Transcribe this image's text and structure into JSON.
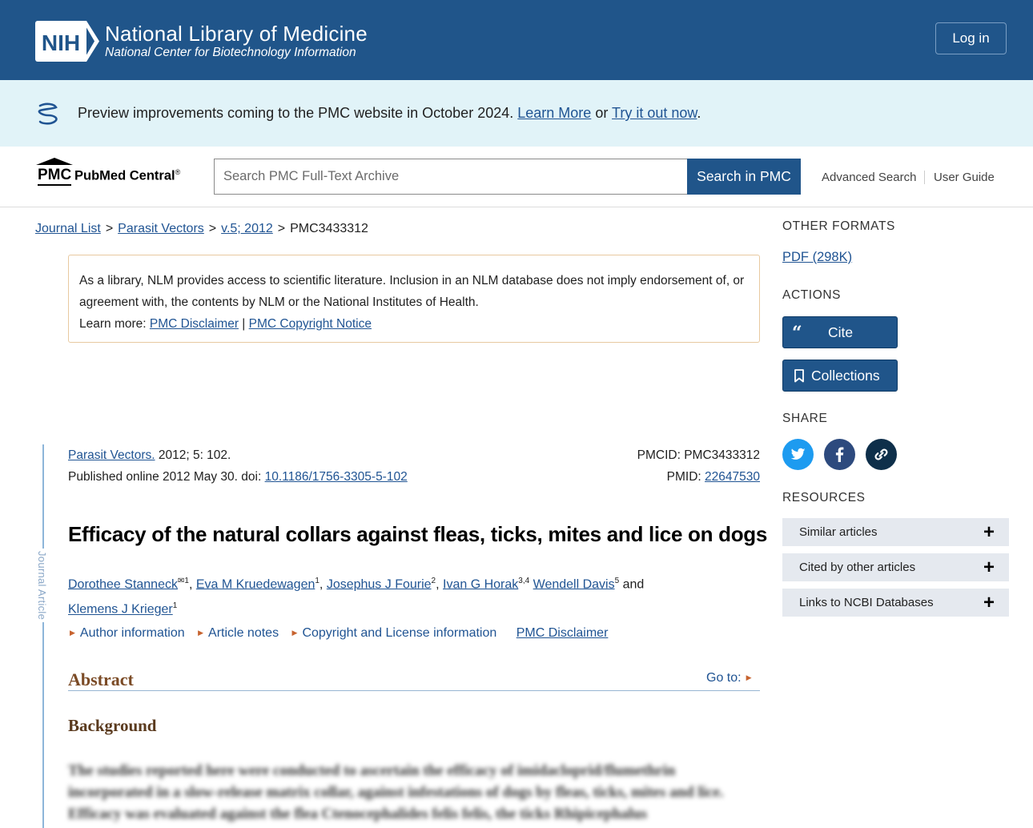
{
  "header": {
    "logo_text": "NIH",
    "title": "National Library of Medicine",
    "subtitle": "National Center for Biotechnology Information",
    "login_label": "Log in",
    "bg_color": "#20558a"
  },
  "banner": {
    "text": "Preview improvements coming to the PMC website in October 2024.",
    "learn_more": "Learn More",
    "or": "or",
    "try_now": "Try it out now",
    "period": ".",
    "icon": "dna-helix-icon"
  },
  "search": {
    "logo_abbr": "PMC",
    "logo_name": "PubMed Central",
    "logo_reg": "®",
    "placeholder": "Search PMC Full-Text Archive",
    "button_label": "Search in PMC",
    "advanced": "Advanced Search",
    "user_guide": "User Guide"
  },
  "breadcrumb": {
    "items": [
      "Journal List",
      "Parasit Vectors",
      "v.5; 2012"
    ],
    "separator": ">",
    "current": "PMC3433312"
  },
  "disclaimer": {
    "text": "As a library, NLM provides access to scientific literature. Inclusion in an NLM database does not imply endorsement of, or agreement with, the contents by NLM or the National Institutes of Health.",
    "learn_more": "Learn more:",
    "link1": "PMC Disclaimer",
    "divider": "|",
    "link2": "PMC Copyright Notice"
  },
  "article": {
    "side_label": "Journal Article",
    "journal": "Parasit Vectors.",
    "citation": "2012; 5: 102.",
    "published": "Published online 2012 May 30. doi:",
    "doi": "10.1186/1756-3305-5-102",
    "pmcid_label": "PMCID:",
    "pmcid": "PMC3433312",
    "pmid_label": "PMID:",
    "pmid": "22647530",
    "title": "Efficacy of the natural collars against fleas, ticks, mites and lice on dogs",
    "authors": [
      {
        "name": "Dorothee Stanneck",
        "sup": "✉1",
        "sep": ", "
      },
      {
        "name": "Eva M Kruedewagen",
        "sup": "1",
        "sep": ", "
      },
      {
        "name": "Josephus J Fourie",
        "sup": "2",
        "sep": ", "
      },
      {
        "name": "Ivan G Horak",
        "sup": "3,4",
        "sep": " "
      },
      {
        "name": "Wendell Davis",
        "sup": "5",
        "sep": " and "
      },
      {
        "name": "Klemens J Krieger",
        "sup": "1",
        "sep": ""
      }
    ],
    "meta_links": [
      "Author information",
      "Article notes",
      "Copyright and License information"
    ],
    "disclaimer_link": "PMC Disclaimer",
    "abstract_heading": "Abstract",
    "goto": "Go to:",
    "background_heading": "Background",
    "abstract_text": "The studies reported here were conducted to ascertain the efficacy of imidacloprid/flumethrin incorporated in a slow-release matrix collar, against infestations of dogs by fleas, ticks, mites and lice. Efficacy was evaluated against the flea Ctenocephalides felis felis, the ticks Rhipicephalus"
  },
  "sidebar": {
    "other_formats": "OTHER FORMATS",
    "pdf": "PDF (298K)",
    "actions": "ACTIONS",
    "cite": "Cite",
    "collections": "Collections",
    "share": "SHARE",
    "share_icons": [
      "twitter-icon",
      "facebook-icon",
      "link-icon"
    ],
    "resources": "RESOURCES",
    "resource_items": [
      "Similar articles",
      "Cited by other articles",
      "Links to NCBI Databases"
    ],
    "plus": "+"
  },
  "colors": {
    "nih_blue": "#20558a",
    "link_blue": "#205493",
    "banner_bg": "#e1f3f8",
    "twitter": "#1d9bf0",
    "facebook": "#3b5998",
    "link_share": "#0e2f4a"
  }
}
